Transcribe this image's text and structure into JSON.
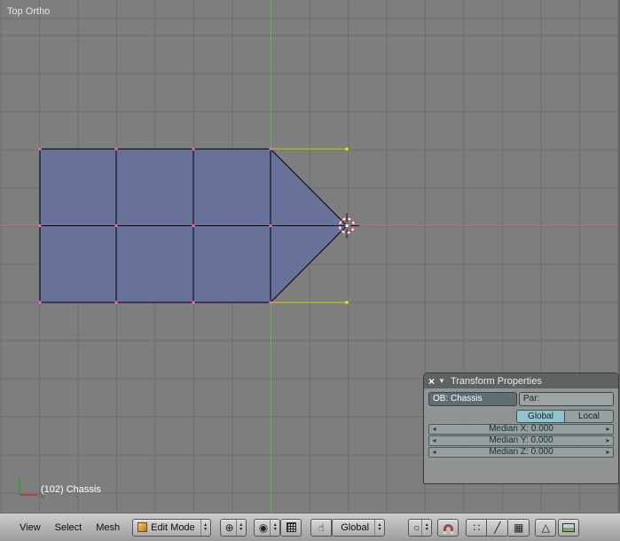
{
  "viewport": {
    "view_label": "Top Ortho",
    "object_info": "(102) Chassis",
    "axis_label_x": "x"
  },
  "transform_panel": {
    "title": "Transform Properties",
    "ob_field": "OB: Chassis",
    "par_field": "Par:",
    "space": {
      "global": "Global",
      "local": "Local"
    },
    "median": {
      "x": "Median X: 0.000",
      "y": "Median Y: 0.000",
      "z": "Median Z: 0.000"
    }
  },
  "header": {
    "menus": [
      "View",
      "Select",
      "Mesh"
    ],
    "mode_dropdown": "Edit Mode",
    "orientation_dropdown": "Global"
  },
  "colors": {
    "mesh_face": "#67719a",
    "mesh_edge": "#000000",
    "selected_edge": "#c9d400",
    "vertex": "#ff5ec4",
    "selected_vertex": "#ffee00",
    "axis_x": "#bb6a6a",
    "axis_y": "#6cae6c",
    "cursor_red": "#d03a3a"
  }
}
